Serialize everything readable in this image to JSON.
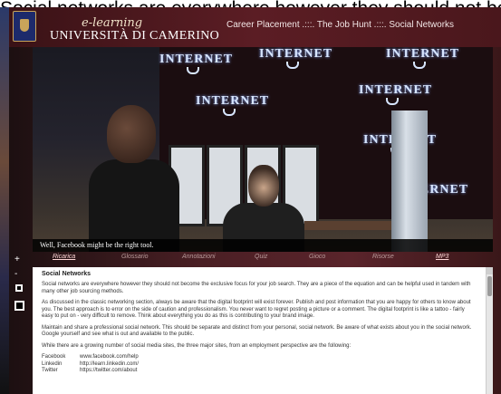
{
  "overlay_text": "Social networks are everywhere however they should not become the exclusive focus for your job search.",
  "header": {
    "brand_script": "e-learning",
    "brand_name": "UNIVERSITÀ DI CAMERINO",
    "breadcrumb": "Career Placement .:::. The Job Hunt .:::. Social Networks"
  },
  "video": {
    "poster_text": "INTERNET",
    "subtitle": "Well, Facebook might be the right tool."
  },
  "side_controls": {
    "plus": "+",
    "minus": "-"
  },
  "tabs": {
    "items": [
      {
        "label": "Ricarica",
        "active": true
      },
      {
        "label": "Glossario",
        "active": false
      },
      {
        "label": "Annotazioni",
        "active": false
      },
      {
        "label": "Quiz",
        "active": false
      },
      {
        "label": "Gioco",
        "active": false
      },
      {
        "label": "Risorse",
        "active": false
      },
      {
        "label": "MP3",
        "active": true
      }
    ]
  },
  "content": {
    "title": "Social Networks",
    "p1": "Social networks are everywhere however they should not become the exclusive focus for your job search. They are a piece of the equation and can be helpful used in tandem with many other job sourcing methods.",
    "p2": "As discussed in the classic networking section, always be aware that the digital footprint will exist forever. Publish and post information that you are happy for others to know about you. The best approach is to error on the side of caution and professionalism. You never want to regret posting a picture or a comment. The digital footprint is like a tattoo - fairly easy to put on - very difficult to remove. Think about everything you do as this is contributing to your brand image.",
    "p3": "Maintain and share a professional social network. This should be separate and distinct from your personal, social network. Be aware of what exists about you in the social network. Google yourself and see what is out and available to the public.",
    "p4": "While there are a growing number of social media sites, the three major sites, from an employment perspective are the following:",
    "sites": [
      {
        "name": "Facebook",
        "url": "www.facebook.com/help"
      },
      {
        "name": "Linkedin",
        "url": "http://learn.linkedin.com/"
      },
      {
        "name": "Twitter",
        "url": "https://twitter.com/about"
      }
    ]
  },
  "colors": {
    "header_bg": "#5b1d24",
    "content_bg": "#ffffff",
    "active_tab": "#ffd7d7"
  }
}
